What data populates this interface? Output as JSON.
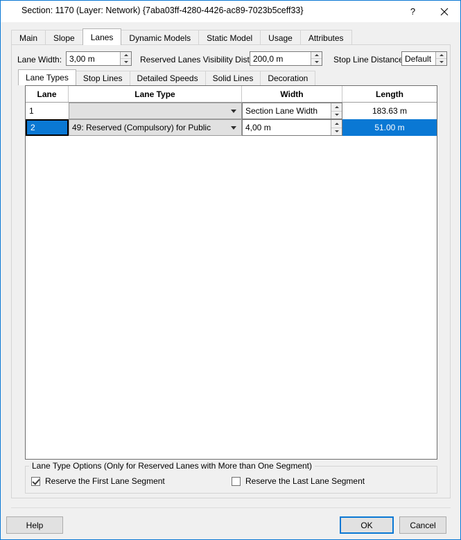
{
  "window": {
    "title": "Section: 1170 (Layer: Network) {7aba03ff-4280-4426-ac89-7023b5ceff33}",
    "help_glyph": "?",
    "close_icon": "close-icon"
  },
  "outer_tabs": [
    {
      "label": "Main",
      "active": false
    },
    {
      "label": "Slope",
      "active": false
    },
    {
      "label": "Lanes",
      "active": true
    },
    {
      "label": "Dynamic Models",
      "active": false
    },
    {
      "label": "Static Model",
      "active": false
    },
    {
      "label": "Usage",
      "active": false
    },
    {
      "label": "Attributes",
      "active": false
    }
  ],
  "controls": {
    "lane_width_label": "Lane Width:",
    "lane_width_value": "3,00 m",
    "reserved_visibility_label": "Reserved Lanes Visibility Distance:",
    "reserved_visibility_value": "200,0 m",
    "stop_line_label": "Stop Line Distance:",
    "stop_line_value": "Default"
  },
  "inner_tabs": [
    {
      "label": "Lane Types",
      "active": true
    },
    {
      "label": "Stop Lines",
      "active": false
    },
    {
      "label": "Detailed Speeds",
      "active": false
    },
    {
      "label": "Solid Lines",
      "active": false
    },
    {
      "label": "Decoration",
      "active": false
    }
  ],
  "grid": {
    "columns": [
      "Lane",
      "Lane Type",
      "Width",
      "Length"
    ],
    "rows": [
      {
        "lane": "1",
        "lane_type": "",
        "width": "Section Lane Width",
        "length": "183.63 m",
        "selected": false
      },
      {
        "lane": "2",
        "lane_type": "49: Reserved (Compulsory) for Public",
        "width": "4,00 m",
        "length": "51.00 m",
        "selected": true
      }
    ]
  },
  "group": {
    "title": "Lane Type Options (Only for Reserved Lanes with More than One Segment)",
    "checkbox_first": {
      "label": "Reserve the First Lane Segment",
      "checked": true
    },
    "checkbox_last": {
      "label": "Reserve the Last Lane Segment",
      "checked": false
    }
  },
  "footer": {
    "help": "Help",
    "ok": "OK",
    "cancel": "Cancel"
  },
  "colors": {
    "accent": "#0a78d4",
    "dialog_bg": "#f0f0f0",
    "selection": "#0a78d4"
  }
}
